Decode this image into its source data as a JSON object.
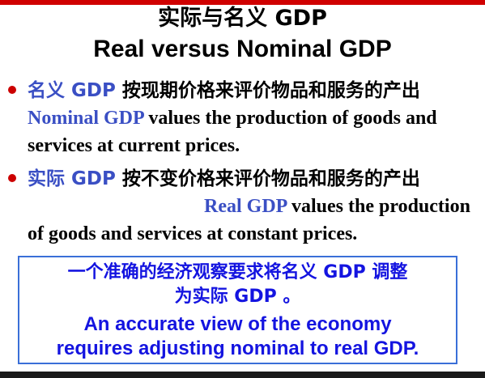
{
  "slide": {
    "title_cn": "实际与名义 GDP",
    "title_en": "Real versus Nominal GDP"
  },
  "bullets": [
    {
      "term_cn": "名义 GDP",
      "text_cn": " 按现期价格来评价物品和服务的产出 ",
      "term_en": "Nominal GDP",
      "text_en": " values the production of goods and services at current prices."
    },
    {
      "term_cn": "实际 GDP",
      "text_cn": " 按不变价格来评价物品和服务的产出",
      "term_en": "Real GDP",
      "text_en": " values the production of goods and services at constant prices."
    }
  ],
  "callout": {
    "line_cn_1": "一个准确的经济观察要求将名义 GDP 调整",
    "line_cn_2": "为实际 GDP 。",
    "line_en_1": "An accurate view of the economy",
    "line_en_2": "requires adjusting nominal to real GDP."
  },
  "colors": {
    "accent_blue": "#3a4fc4",
    "callout_text": "#1414e0",
    "bullet_red": "#cc0000",
    "top_bar": "#d00000"
  }
}
